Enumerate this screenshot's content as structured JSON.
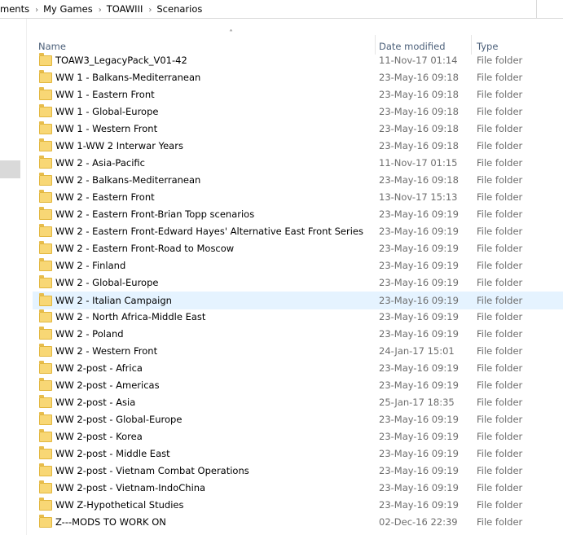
{
  "breadcrumb": [
    "ments",
    "My Games",
    "TOAWIII",
    "Scenarios"
  ],
  "columns": {
    "name": "Name",
    "date": "Date modified",
    "type": "Type"
  },
  "selected_index": 14,
  "rows": [
    {
      "name": "TOAW3_LegacyPack_V01-42",
      "date": "11-Nov-17 01:14",
      "type": "File folder"
    },
    {
      "name": "WW 1 - Balkans-Mediterranean",
      "date": "23-May-16 09:18",
      "type": "File folder"
    },
    {
      "name": "WW 1 - Eastern Front",
      "date": "23-May-16 09:18",
      "type": "File folder"
    },
    {
      "name": "WW 1 - Global-Europe",
      "date": "23-May-16 09:18",
      "type": "File folder"
    },
    {
      "name": "WW 1 - Western Front",
      "date": "23-May-16 09:18",
      "type": "File folder"
    },
    {
      "name": "WW 1-WW 2 Interwar Years",
      "date": "23-May-16 09:18",
      "type": "File folder"
    },
    {
      "name": "WW 2 - Asia-Pacific",
      "date": "11-Nov-17 01:15",
      "type": "File folder"
    },
    {
      "name": "WW 2 - Balkans-Mediterranean",
      "date": "23-May-16 09:18",
      "type": "File folder"
    },
    {
      "name": "WW 2 - Eastern Front",
      "date": "13-Nov-17 15:13",
      "type": "File folder"
    },
    {
      "name": "WW 2 - Eastern Front-Brian Topp scenarios",
      "date": "23-May-16 09:19",
      "type": "File folder"
    },
    {
      "name": "WW 2 - Eastern Front-Edward Hayes' Alternative East Front Series",
      "date": "23-May-16 09:19",
      "type": "File folder"
    },
    {
      "name": "WW 2 - Eastern Front-Road to Moscow",
      "date": "23-May-16 09:19",
      "type": "File folder"
    },
    {
      "name": "WW 2 - Finland",
      "date": "23-May-16 09:19",
      "type": "File folder"
    },
    {
      "name": "WW 2 - Global-Europe",
      "date": "23-May-16 09:19",
      "type": "File folder"
    },
    {
      "name": "WW 2 - Italian Campaign",
      "date": "23-May-16 09:19",
      "type": "File folder"
    },
    {
      "name": "WW 2 - North Africa-Middle East",
      "date": "23-May-16 09:19",
      "type": "File folder"
    },
    {
      "name": "WW 2 - Poland",
      "date": "23-May-16 09:19",
      "type": "File folder"
    },
    {
      "name": "WW 2 - Western Front",
      "date": "24-Jan-17 15:01",
      "type": "File folder"
    },
    {
      "name": "WW 2-post - Africa",
      "date": "23-May-16 09:19",
      "type": "File folder"
    },
    {
      "name": "WW 2-post - Americas",
      "date": "23-May-16 09:19",
      "type": "File folder"
    },
    {
      "name": "WW 2-post - Asia",
      "date": "25-Jan-17 18:35",
      "type": "File folder"
    },
    {
      "name": "WW 2-post - Global-Europe",
      "date": "23-May-16 09:19",
      "type": "File folder"
    },
    {
      "name": "WW 2-post - Korea",
      "date": "23-May-16 09:19",
      "type": "File folder"
    },
    {
      "name": "WW 2-post - Middle East",
      "date": "23-May-16 09:19",
      "type": "File folder"
    },
    {
      "name": "WW 2-post - Vietnam Combat Operations",
      "date": "23-May-16 09:19",
      "type": "File folder"
    },
    {
      "name": "WW 2-post - Vietnam-IndoChina",
      "date": "23-May-16 09:19",
      "type": "File folder"
    },
    {
      "name": "WW Z-Hypothetical Studies",
      "date": "23-May-16 09:19",
      "type": "File folder"
    },
    {
      "name": "Z---MODS TO WORK ON",
      "date": "02-Dec-16 22:39",
      "type": "File folder"
    }
  ]
}
